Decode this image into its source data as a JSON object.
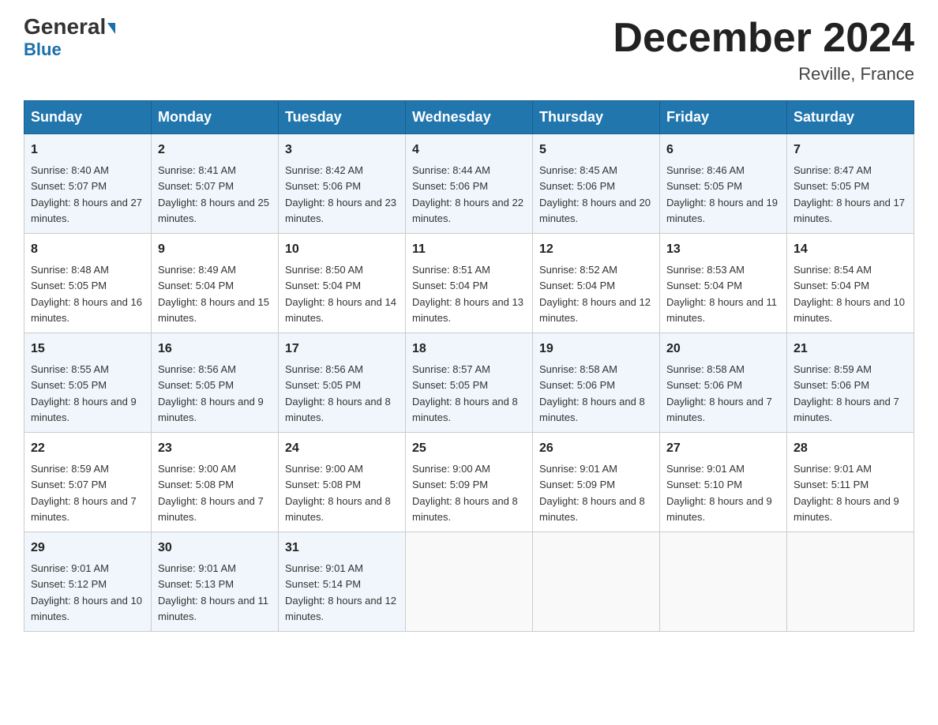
{
  "header": {
    "logo_general": "General",
    "logo_blue": "Blue",
    "month_title": "December 2024",
    "location": "Reville, France"
  },
  "weekdays": [
    "Sunday",
    "Monday",
    "Tuesday",
    "Wednesday",
    "Thursday",
    "Friday",
    "Saturday"
  ],
  "weeks": [
    [
      {
        "day": "1",
        "sunrise": "8:40 AM",
        "sunset": "5:07 PM",
        "daylight": "8 hours and 27 minutes."
      },
      {
        "day": "2",
        "sunrise": "8:41 AM",
        "sunset": "5:07 PM",
        "daylight": "8 hours and 25 minutes."
      },
      {
        "day": "3",
        "sunrise": "8:42 AM",
        "sunset": "5:06 PM",
        "daylight": "8 hours and 23 minutes."
      },
      {
        "day": "4",
        "sunrise": "8:44 AM",
        "sunset": "5:06 PM",
        "daylight": "8 hours and 22 minutes."
      },
      {
        "day": "5",
        "sunrise": "8:45 AM",
        "sunset": "5:06 PM",
        "daylight": "8 hours and 20 minutes."
      },
      {
        "day": "6",
        "sunrise": "8:46 AM",
        "sunset": "5:05 PM",
        "daylight": "8 hours and 19 minutes."
      },
      {
        "day": "7",
        "sunrise": "8:47 AM",
        "sunset": "5:05 PM",
        "daylight": "8 hours and 17 minutes."
      }
    ],
    [
      {
        "day": "8",
        "sunrise": "8:48 AM",
        "sunset": "5:05 PM",
        "daylight": "8 hours and 16 minutes."
      },
      {
        "day": "9",
        "sunrise": "8:49 AM",
        "sunset": "5:04 PM",
        "daylight": "8 hours and 15 minutes."
      },
      {
        "day": "10",
        "sunrise": "8:50 AM",
        "sunset": "5:04 PM",
        "daylight": "8 hours and 14 minutes."
      },
      {
        "day": "11",
        "sunrise": "8:51 AM",
        "sunset": "5:04 PM",
        "daylight": "8 hours and 13 minutes."
      },
      {
        "day": "12",
        "sunrise": "8:52 AM",
        "sunset": "5:04 PM",
        "daylight": "8 hours and 12 minutes."
      },
      {
        "day": "13",
        "sunrise": "8:53 AM",
        "sunset": "5:04 PM",
        "daylight": "8 hours and 11 minutes."
      },
      {
        "day": "14",
        "sunrise": "8:54 AM",
        "sunset": "5:04 PM",
        "daylight": "8 hours and 10 minutes."
      }
    ],
    [
      {
        "day": "15",
        "sunrise": "8:55 AM",
        "sunset": "5:05 PM",
        "daylight": "8 hours and 9 minutes."
      },
      {
        "day": "16",
        "sunrise": "8:56 AM",
        "sunset": "5:05 PM",
        "daylight": "8 hours and 9 minutes."
      },
      {
        "day": "17",
        "sunrise": "8:56 AM",
        "sunset": "5:05 PM",
        "daylight": "8 hours and 8 minutes."
      },
      {
        "day": "18",
        "sunrise": "8:57 AM",
        "sunset": "5:05 PM",
        "daylight": "8 hours and 8 minutes."
      },
      {
        "day": "19",
        "sunrise": "8:58 AM",
        "sunset": "5:06 PM",
        "daylight": "8 hours and 8 minutes."
      },
      {
        "day": "20",
        "sunrise": "8:58 AM",
        "sunset": "5:06 PM",
        "daylight": "8 hours and 7 minutes."
      },
      {
        "day": "21",
        "sunrise": "8:59 AM",
        "sunset": "5:06 PM",
        "daylight": "8 hours and 7 minutes."
      }
    ],
    [
      {
        "day": "22",
        "sunrise": "8:59 AM",
        "sunset": "5:07 PM",
        "daylight": "8 hours and 7 minutes."
      },
      {
        "day": "23",
        "sunrise": "9:00 AM",
        "sunset": "5:08 PM",
        "daylight": "8 hours and 7 minutes."
      },
      {
        "day": "24",
        "sunrise": "9:00 AM",
        "sunset": "5:08 PM",
        "daylight": "8 hours and 8 minutes."
      },
      {
        "day": "25",
        "sunrise": "9:00 AM",
        "sunset": "5:09 PM",
        "daylight": "8 hours and 8 minutes."
      },
      {
        "day": "26",
        "sunrise": "9:01 AM",
        "sunset": "5:09 PM",
        "daylight": "8 hours and 8 minutes."
      },
      {
        "day": "27",
        "sunrise": "9:01 AM",
        "sunset": "5:10 PM",
        "daylight": "8 hours and 9 minutes."
      },
      {
        "day": "28",
        "sunrise": "9:01 AM",
        "sunset": "5:11 PM",
        "daylight": "8 hours and 9 minutes."
      }
    ],
    [
      {
        "day": "29",
        "sunrise": "9:01 AM",
        "sunset": "5:12 PM",
        "daylight": "8 hours and 10 minutes."
      },
      {
        "day": "30",
        "sunrise": "9:01 AM",
        "sunset": "5:13 PM",
        "daylight": "8 hours and 11 minutes."
      },
      {
        "day": "31",
        "sunrise": "9:01 AM",
        "sunset": "5:14 PM",
        "daylight": "8 hours and 12 minutes."
      },
      null,
      null,
      null,
      null
    ]
  ]
}
